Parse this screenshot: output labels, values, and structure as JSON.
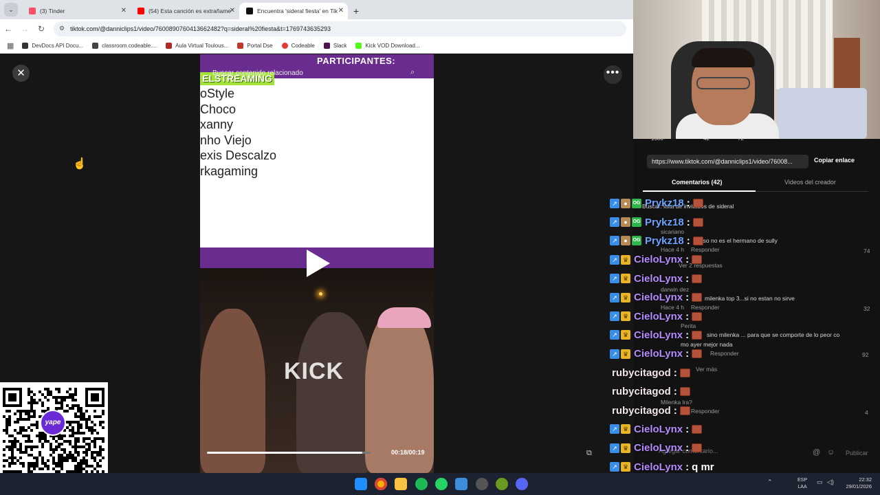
{
  "browser": {
    "tabs": [
      {
        "label": "(3) Tinder",
        "icon_color": "#fd5068"
      },
      {
        "label": "(54) Esta canción es extrañame",
        "icon_color": "#ff0000"
      },
      {
        "label": "Encuentra 'sideral fiesta' en Tik",
        "icon_color": "#111111"
      }
    ],
    "new_tab": "+",
    "url": "tiktok.com/@danniclips1/video/7600890760413662482?q=sideral%20fiesta&t=1769743635293",
    "bookmarks": [
      {
        "label": "DevDocs API Docu...",
        "color": "#333333"
      },
      {
        "label": "classroom.codeable....",
        "color": "#444444"
      },
      {
        "label": "Aula Virtual Toulous...",
        "color": "#b02a2a"
      },
      {
        "label": "Portal Dse",
        "color": "#c0392b"
      },
      {
        "label": "Codeable",
        "color": "#e53935"
      },
      {
        "label": "Slack",
        "color": "#4a154b"
      },
      {
        "label": "Kick VOD Download...",
        "color": "#53fc18"
      }
    ]
  },
  "video": {
    "participants_title": "PARTICIPANTES:",
    "search_related": "Buscar contenido relacionado",
    "streaming_banner": "ELSTREAMING",
    "participants": [
      "oStyle",
      "Choco",
      "xanny",
      "nho Viejo",
      "exis Descalzo",
      "rkagaming"
    ],
    "overlay_logo": "KICK",
    "timecode": "00:18/00:19",
    "progress": 0.95
  },
  "panel": {
    "link": "https://www.tiktok.com/@danniclips1/video/76008...",
    "copy_link": "Copiar enlace",
    "stats": [
      "1308",
      "42",
      "72"
    ],
    "tabs": [
      "Comentarios (42)",
      "Videos del creador"
    ],
    "faded_comments": [
      "Buscar: lista de invitados de sideral",
      "sicariano",
      "Acaso no es el hermano de sully",
      "Hace 4 h",
      "Responder",
      "74",
      "Ver 2 respuestas",
      "darwin dez",
      "milenka top 3...si no estan no sirve",
      "32",
      "Perita",
      "sino milenka ... para que se comporte de lo peor co",
      "mo ayer mejor nada",
      "92",
      "Ver más",
      "Milenka lra?",
      "4",
      "Agregar comentario...",
      "Publicar"
    ]
  },
  "chat": [
    {
      "user": "Prykz18",
      "color": "#6fa3ff",
      "badges": [
        "arrow",
        "poop",
        "og"
      ],
      "text": ""
    },
    {
      "user": "Prykz18",
      "color": "#6fa3ff",
      "badges": [
        "arrow",
        "poop",
        "og"
      ],
      "text": ""
    },
    {
      "user": "Prykz18",
      "color": "#6fa3ff",
      "badges": [
        "arrow",
        "poop",
        "og"
      ],
      "text": ""
    },
    {
      "user": "CieloLynx",
      "color": "#b58bff",
      "badges": [
        "arrow",
        "crown"
      ],
      "text": ""
    },
    {
      "user": "CieloLynx",
      "color": "#b58bff",
      "badges": [
        "arrow",
        "crown"
      ],
      "text": ""
    },
    {
      "user": "CieloLynx",
      "color": "#b58bff",
      "badges": [
        "arrow",
        "crown"
      ],
      "text": ""
    },
    {
      "user": "CieloLynx",
      "color": "#b58bff",
      "badges": [
        "arrow",
        "crown"
      ],
      "text": ""
    },
    {
      "user": "CieloLynx",
      "color": "#b58bff",
      "badges": [
        "arrow",
        "crown"
      ],
      "text": ""
    },
    {
      "user": "CieloLynx",
      "color": "#b58bff",
      "badges": [
        "arrow",
        "crown"
      ],
      "text": ""
    },
    {
      "user": "rubycitagod",
      "color": "#f2e6e6",
      "badges": [],
      "text": ""
    },
    {
      "user": "rubycitagod",
      "color": "#f2e6e6",
      "badges": [],
      "text": ""
    },
    {
      "user": "rubycitagod",
      "color": "#f2e6e6",
      "badges": [],
      "text": ""
    },
    {
      "user": "CieloLynx",
      "color": "#b58bff",
      "badges": [
        "arrow",
        "crown"
      ],
      "text": ""
    },
    {
      "user": "CieloLynx",
      "color": "#b58bff",
      "badges": [
        "arrow",
        "crown"
      ],
      "text": ""
    },
    {
      "user": "CieloLynx",
      "color": "#b58bff",
      "badges": [
        "arrow",
        "crown"
      ],
      "text": "q mr"
    },
    {
      "user": "CieloLynx",
      "color": "#b58bff",
      "badges": [
        "arrow",
        "crown"
      ],
      "text": ""
    }
  ],
  "qr": {
    "badge": "yape"
  },
  "taskbar": {
    "apps": [
      "windows-start",
      "chrome",
      "file-explorer",
      "spotify",
      "whatsapp",
      "photos",
      "capture",
      "xbox",
      "discord"
    ],
    "lang": [
      "ESP",
      "LAA"
    ],
    "time": "22:32",
    "date": "29/01/2026"
  }
}
